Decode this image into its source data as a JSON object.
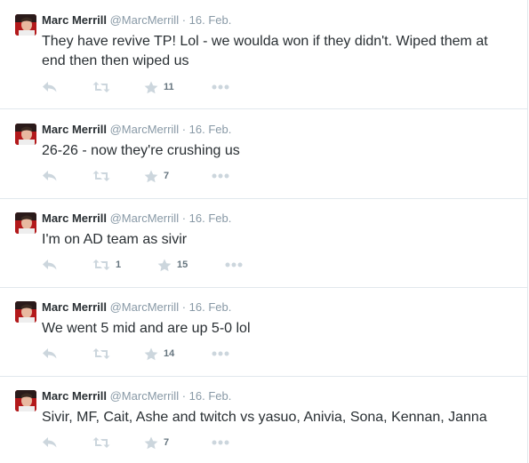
{
  "tweets": [
    {
      "fullname": "Marc Merrill",
      "username": "@MarcMerrill",
      "separator": "·",
      "time": "16. Feb.",
      "text": "They have revive TP!  Lol - we woulda won if they didn't.  Wiped them at end then then wiped us",
      "retweets": "",
      "favorites": "11"
    },
    {
      "fullname": "Marc Merrill",
      "username": "@MarcMerrill",
      "separator": "·",
      "time": "16. Feb.",
      "text": "26-26 - now they're crushing us",
      "retweets": "",
      "favorites": "7"
    },
    {
      "fullname": "Marc Merrill",
      "username": "@MarcMerrill",
      "separator": "·",
      "time": "16. Feb.",
      "text": "I'm on AD team as sivir",
      "retweets": "1",
      "favorites": "15"
    },
    {
      "fullname": "Marc Merrill",
      "username": "@MarcMerrill",
      "separator": "·",
      "time": "16. Feb.",
      "text": "We went 5 mid and are up 5-0 lol",
      "retweets": "",
      "favorites": "14"
    },
    {
      "fullname": "Marc Merrill",
      "username": "@MarcMerrill",
      "separator": "·",
      "time": "16. Feb.",
      "text": "Sivir, MF, Cait, Ashe and twitch vs yasuo, Anivia, Sona, Kennan, Janna",
      "retweets": "",
      "favorites": "7"
    }
  ],
  "icons": {
    "reply": "reply-icon",
    "retweet": "retweet-icon",
    "favorite": "star-icon",
    "more": "more-icon"
  },
  "colors": {
    "text": "#292f33",
    "muted": "#8899a6",
    "icon": "#ccd6dd",
    "border": "#e1e8ed"
  }
}
